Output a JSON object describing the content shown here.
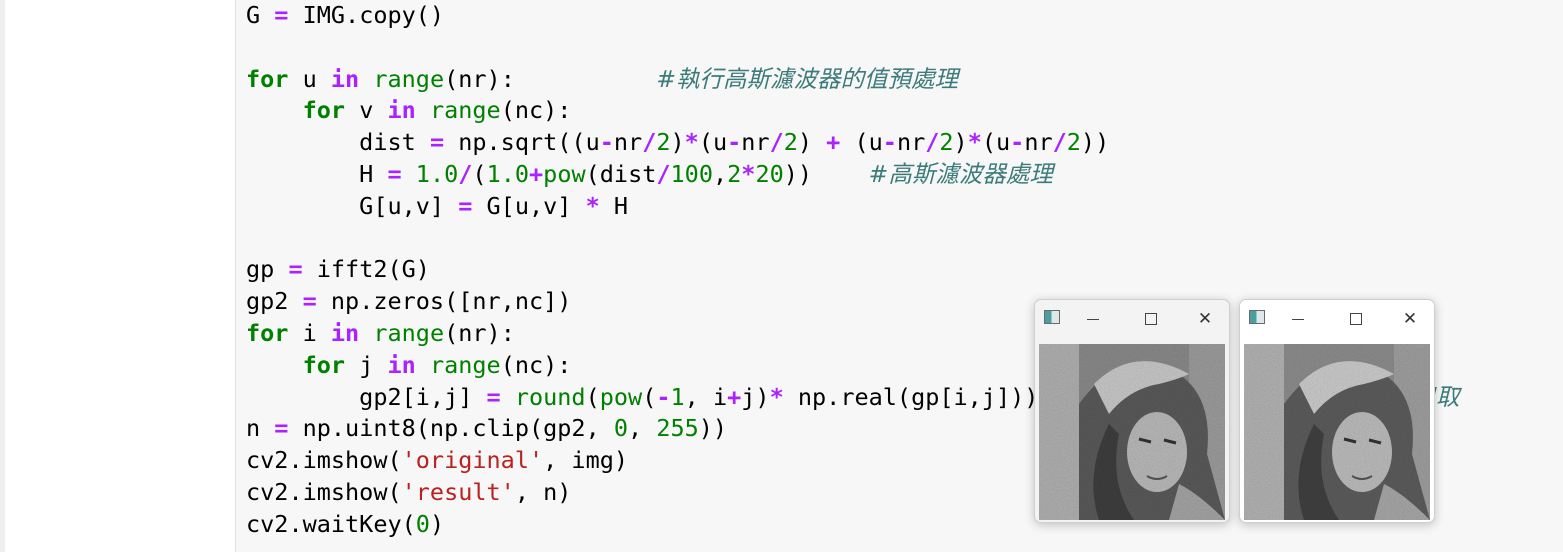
{
  "code_lines": [
    [
      {
        "t": "G ",
        "c": ""
      },
      {
        "t": "=",
        "c": "op"
      },
      {
        "t": " IMG.copy()",
        "c": ""
      }
    ],
    [],
    [
      {
        "t": "for",
        "c": "kw"
      },
      {
        "t": " u ",
        "c": ""
      },
      {
        "t": "in",
        "c": "kwb"
      },
      {
        "t": " ",
        "c": ""
      },
      {
        "t": "range",
        "c": "bi"
      },
      {
        "t": "(nr):          ",
        "c": ""
      },
      {
        "t": "#執行高斯濾波器的值預處理",
        "c": "cm"
      }
    ],
    [
      {
        "t": "    ",
        "c": ""
      },
      {
        "t": "for",
        "c": "kw"
      },
      {
        "t": " v ",
        "c": ""
      },
      {
        "t": "in",
        "c": "kwb"
      },
      {
        "t": " ",
        "c": ""
      },
      {
        "t": "range",
        "c": "bi"
      },
      {
        "t": "(nc):",
        "c": ""
      }
    ],
    [
      {
        "t": "        dist ",
        "c": ""
      },
      {
        "t": "=",
        "c": "op"
      },
      {
        "t": " np.sqrt((u",
        "c": ""
      },
      {
        "t": "-",
        "c": "op"
      },
      {
        "t": "nr",
        "c": ""
      },
      {
        "t": "/",
        "c": "op"
      },
      {
        "t": "2",
        "c": "num"
      },
      {
        "t": ")",
        "c": ""
      },
      {
        "t": "*",
        "c": "op"
      },
      {
        "t": "(u",
        "c": ""
      },
      {
        "t": "-",
        "c": "op"
      },
      {
        "t": "nr",
        "c": ""
      },
      {
        "t": "/",
        "c": "op"
      },
      {
        "t": "2",
        "c": "num"
      },
      {
        "t": ") ",
        "c": ""
      },
      {
        "t": "+",
        "c": "op"
      },
      {
        "t": " (u",
        "c": ""
      },
      {
        "t": "-",
        "c": "op"
      },
      {
        "t": "nr",
        "c": ""
      },
      {
        "t": "/",
        "c": "op"
      },
      {
        "t": "2",
        "c": "num"
      },
      {
        "t": ")",
        "c": ""
      },
      {
        "t": "*",
        "c": "op"
      },
      {
        "t": "(u",
        "c": ""
      },
      {
        "t": "-",
        "c": "op"
      },
      {
        "t": "nr",
        "c": ""
      },
      {
        "t": "/",
        "c": "op"
      },
      {
        "t": "2",
        "c": "num"
      },
      {
        "t": "))",
        "c": ""
      }
    ],
    [
      {
        "t": "        H ",
        "c": ""
      },
      {
        "t": "=",
        "c": "op"
      },
      {
        "t": " ",
        "c": ""
      },
      {
        "t": "1.0",
        "c": "num"
      },
      {
        "t": "/",
        "c": "op"
      },
      {
        "t": "(",
        "c": ""
      },
      {
        "t": "1.0",
        "c": "num"
      },
      {
        "t": "+",
        "c": "op"
      },
      {
        "t": "pow",
        "c": "bi"
      },
      {
        "t": "(dist",
        "c": ""
      },
      {
        "t": "/",
        "c": "op"
      },
      {
        "t": "100",
        "c": "num"
      },
      {
        "t": ",",
        "c": ""
      },
      {
        "t": "2",
        "c": "num"
      },
      {
        "t": "*",
        "c": "op"
      },
      {
        "t": "20",
        "c": "num"
      },
      {
        "t": "))    ",
        "c": ""
      },
      {
        "t": "#高斯濾波器處理",
        "c": "cm"
      }
    ],
    [
      {
        "t": "        G[u,v] ",
        "c": ""
      },
      {
        "t": "=",
        "c": "op"
      },
      {
        "t": " G[u,v] ",
        "c": ""
      },
      {
        "t": "*",
        "c": "op"
      },
      {
        "t": " H",
        "c": ""
      }
    ],
    [],
    [
      {
        "t": "gp ",
        "c": ""
      },
      {
        "t": "=",
        "c": "op"
      },
      {
        "t": " ifft2(G)",
        "c": ""
      }
    ],
    [
      {
        "t": "gp2 ",
        "c": ""
      },
      {
        "t": "=",
        "c": "op"
      },
      {
        "t": " np.zeros([nr,nc])",
        "c": ""
      }
    ],
    [
      {
        "t": "for",
        "c": "kw"
      },
      {
        "t": " i ",
        "c": ""
      },
      {
        "t": "in",
        "c": "kwb"
      },
      {
        "t": " ",
        "c": ""
      },
      {
        "t": "range",
        "c": "bi"
      },
      {
        "t": "(nr):",
        "c": ""
      }
    ],
    [
      {
        "t": "    ",
        "c": ""
      },
      {
        "t": "for",
        "c": "kw"
      },
      {
        "t": " j ",
        "c": ""
      },
      {
        "t": "in",
        "c": "kwb"
      },
      {
        "t": " ",
        "c": ""
      },
      {
        "t": "range",
        "c": "bi"
      },
      {
        "t": "(nc):",
        "c": ""
      }
    ],
    [
      {
        "t": "        gp2[i,j] ",
        "c": ""
      },
      {
        "t": "=",
        "c": "op"
      },
      {
        "t": " ",
        "c": ""
      },
      {
        "t": "round",
        "c": "bi"
      },
      {
        "t": "(",
        "c": ""
      },
      {
        "t": "pow",
        "c": "bi"
      },
      {
        "t": "(",
        "c": ""
      },
      {
        "t": "-",
        "c": "op"
      },
      {
        "t": "1",
        "c": "num"
      },
      {
        "t": ", i",
        "c": ""
      },
      {
        "t": "+",
        "c": "op"
      },
      {
        "t": "j)",
        "c": ""
      },
      {
        "t": "*",
        "c": "op"
      },
      {
        "t": " np.real(gp[i,j]))",
        "c": ""
      },
      {
        "t": "                  ",
        "c": ""
      },
      {
        "t": "i",
        "c": "cm"
      },
      {
        "t": "   ",
        "c": ""
      },
      {
        "t": "虛數，只取",
        "c": "cm"
      }
    ],
    [
      {
        "t": "n ",
        "c": ""
      },
      {
        "t": "=",
        "c": "op"
      },
      {
        "t": " np.uint8(np.clip(gp2, ",
        "c": ""
      },
      {
        "t": "0",
        "c": "num"
      },
      {
        "t": ", ",
        "c": ""
      },
      {
        "t": "255",
        "c": "num"
      },
      {
        "t": "))",
        "c": ""
      }
    ],
    [
      {
        "t": "cv2.imshow(",
        "c": ""
      },
      {
        "t": "'original'",
        "c": "str"
      },
      {
        "t": ", img)",
        "c": ""
      }
    ],
    [
      {
        "t": "cv2.imshow(",
        "c": ""
      },
      {
        "t": "'result'",
        "c": "str"
      },
      {
        "t": ", n)",
        "c": ""
      }
    ],
    [
      {
        "t": "cv2.waitKey(",
        "c": ""
      },
      {
        "t": "0",
        "c": "num"
      },
      {
        "t": ")",
        "c": ""
      }
    ]
  ],
  "windows": [
    {
      "minimize": "─",
      "maximize": "□",
      "close": "✕"
    },
    {
      "minimize": "─",
      "maximize": "□",
      "close": "✕"
    }
  ],
  "colors": {
    "keyword": "#008000",
    "operator": "#aa22ff",
    "number": "#008000",
    "string": "#ba2121",
    "comment": "#3d7b7b",
    "cell_bg": "#f7f7f7"
  }
}
